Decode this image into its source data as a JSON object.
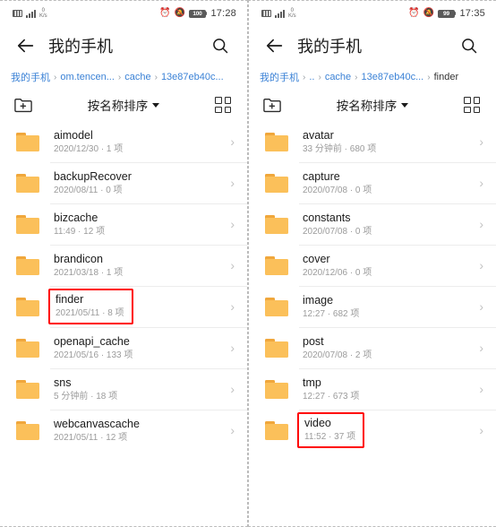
{
  "panels": [
    {
      "id": "left",
      "status": {
        "net_speed_value": "0",
        "net_speed_unit": "K/s",
        "sim_icon": "sim-card-icon",
        "signal_icon": "signal-bars-icon",
        "alarm_icon": "alarm-clock-icon",
        "mute_icon": "mute-bell-icon",
        "battery_level": "100",
        "time": "17:28"
      },
      "app_bar": {
        "back_icon": "back-arrow-icon",
        "title": "我的手机",
        "search_icon": "search-icon"
      },
      "breadcrumb": [
        {
          "label": "我的手机",
          "current": false
        },
        {
          "label": "om.tencen...",
          "current": false
        },
        {
          "label": "cache",
          "current": false
        },
        {
          "label": "13e87eb40c...",
          "current": false
        }
      ],
      "toolbar": {
        "new_folder_icon": "new-folder-icon",
        "sort_label": "按名称排序",
        "caret_icon": "chevron-down-icon",
        "grid_icon": "grid-view-icon"
      },
      "files": [
        {
          "name": "aimodel",
          "sub": "2020/12/30 · 1 项",
          "highlight": false
        },
        {
          "name": "backupRecover",
          "sub": "2020/08/11 · 0 项",
          "highlight": false
        },
        {
          "name": "bizcache",
          "sub": "11:49 · 12 项",
          "highlight": false
        },
        {
          "name": "brandicon",
          "sub": "2021/03/18 · 1 项",
          "highlight": false
        },
        {
          "name": "finder",
          "sub": "2021/05/11 · 8 项",
          "highlight": true
        },
        {
          "name": "openapi_cache",
          "sub": "2021/05/16 · 133 项",
          "highlight": false
        },
        {
          "name": "sns",
          "sub": "5 分钟前 · 18 项",
          "highlight": false
        },
        {
          "name": "webcanvascache",
          "sub": "2021/05/11 · 12 项",
          "highlight": false
        }
      ]
    },
    {
      "id": "right",
      "status": {
        "net_speed_value": "0",
        "net_speed_unit": "K/s",
        "sim_icon": "sim-card-icon",
        "signal_icon": "signal-bars-icon",
        "alarm_icon": "alarm-clock-icon",
        "mute_icon": "mute-bell-icon",
        "battery_level": "99",
        "time": "17:35"
      },
      "app_bar": {
        "back_icon": "back-arrow-icon",
        "title": "我的手机",
        "search_icon": "search-icon"
      },
      "breadcrumb": [
        {
          "label": "我的手机",
          "current": false
        },
        {
          "label": "..",
          "current": false
        },
        {
          "label": "cache",
          "current": false
        },
        {
          "label": "13e87eb40c...",
          "current": false
        },
        {
          "label": "finder",
          "current": true
        }
      ],
      "toolbar": {
        "new_folder_icon": "new-folder-icon",
        "sort_label": "按名称排序",
        "caret_icon": "chevron-down-icon",
        "grid_icon": "grid-view-icon"
      },
      "files": [
        {
          "name": "avatar",
          "sub": "33 分钟前 · 680 项",
          "highlight": false
        },
        {
          "name": "capture",
          "sub": "2020/07/08 · 0 项",
          "highlight": false
        },
        {
          "name": "constants",
          "sub": "2020/07/08 · 0 项",
          "highlight": false
        },
        {
          "name": "cover",
          "sub": "2020/12/06 · 0 项",
          "highlight": false
        },
        {
          "name": "image",
          "sub": "12:27 · 682 项",
          "highlight": false
        },
        {
          "name": "post",
          "sub": "2020/07/08 · 2 项",
          "highlight": false
        },
        {
          "name": "tmp",
          "sub": "12:27 · 673 项",
          "highlight": false
        },
        {
          "name": "video",
          "sub": "11:52 · 37 项",
          "highlight": true
        }
      ]
    }
  ],
  "colors": {
    "folder": "#fbc05a",
    "folder_tab": "#f0a73c",
    "link": "#3b82d6",
    "highlight": "#ff0000"
  }
}
